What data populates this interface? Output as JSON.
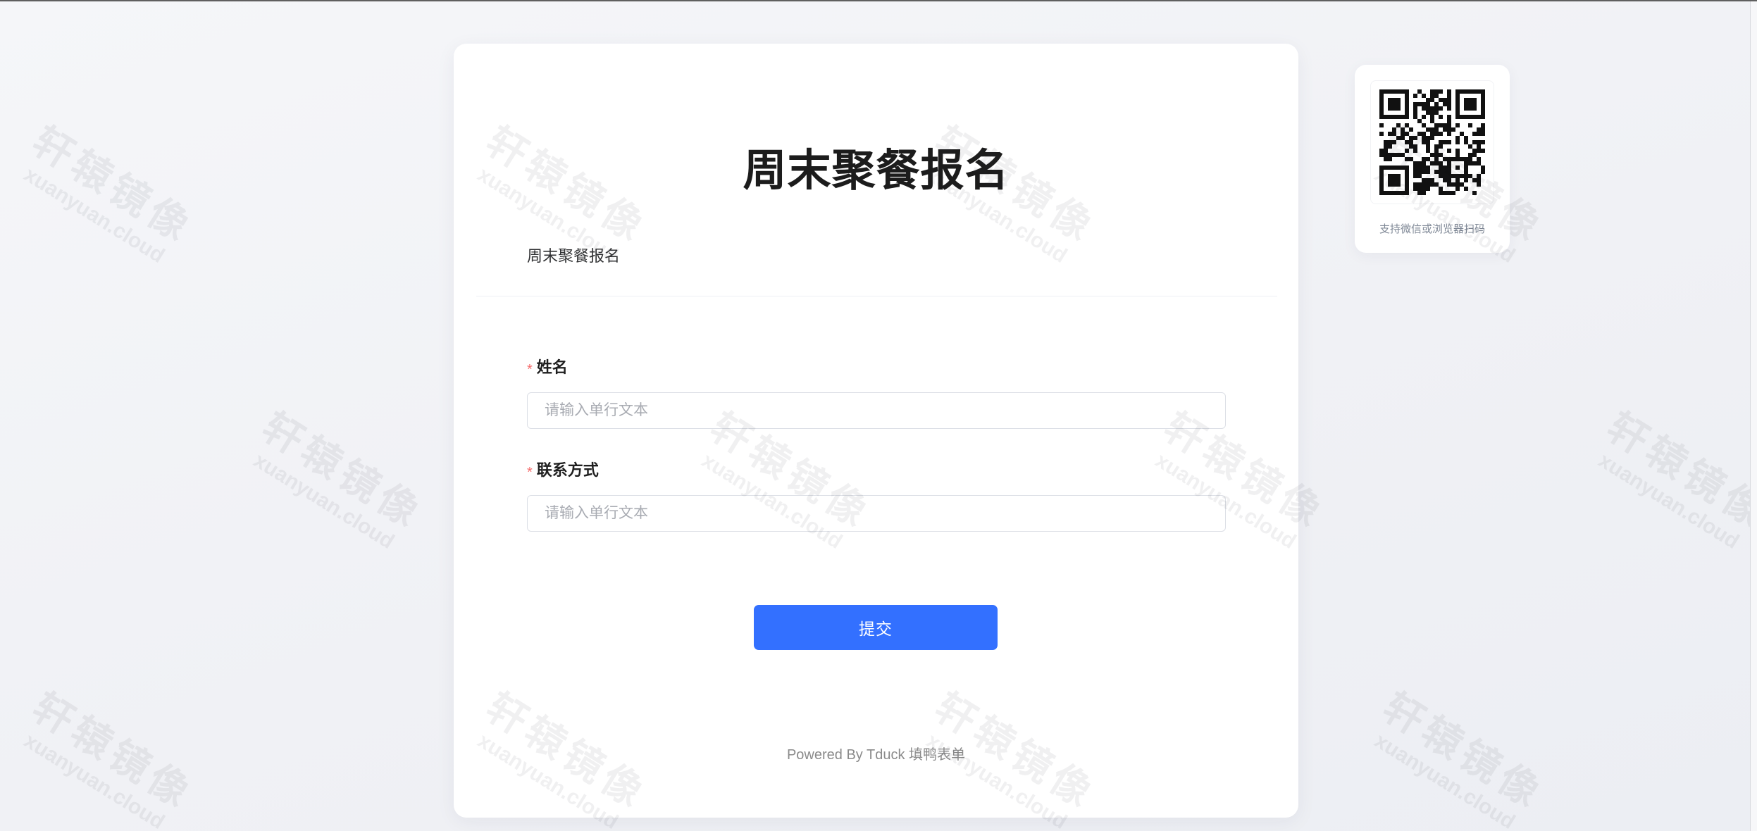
{
  "form": {
    "title": "周末聚餐报名",
    "description": "周末聚餐报名",
    "fields": [
      {
        "required_mark": "*",
        "label": "姓名",
        "placeholder": "请输入单行文本"
      },
      {
        "required_mark": "*",
        "label": "联系方式",
        "placeholder": "请输入单行文本"
      }
    ],
    "submit_label": "提交",
    "footer": "Powered By Tduck 填鸭表单"
  },
  "qr": {
    "icon": "qr-code-icon",
    "caption": "支持微信或浏览器扫码"
  },
  "watermark": {
    "text": "轩辕镜像",
    "subtext": "xuanyuan.cloud"
  },
  "colors": {
    "accent": "#3370ff",
    "required": "#f56c6c",
    "background": "#f0f1f5",
    "card": "#ffffff"
  }
}
